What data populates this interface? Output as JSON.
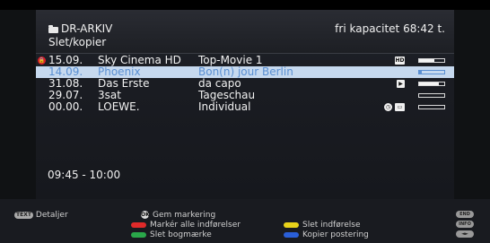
{
  "header": {
    "title_line1": "DR-ARKIV",
    "title_line2": "Slet/kopier",
    "capacity": "fri kapacitet 68:42 t."
  },
  "recordings": [
    {
      "date": "15.09.",
      "channel": "Sky Cinema HD",
      "title": "Top-Movie 1",
      "locked": true,
      "icons": [
        "hd-icon"
      ],
      "progress": 0.6
    },
    {
      "date": "14.09.",
      "channel": "Phoenix",
      "title": "Bon(n) jour Berlin",
      "selected": true,
      "icons": [],
      "progress": 0.1
    },
    {
      "date": "31.08.",
      "channel": "Das Erste",
      "title": "da capo",
      "icons": [
        "play-icon"
      ],
      "progress": 0.8
    },
    {
      "date": "29.07.",
      "channel": "3sat",
      "title": "Tageschau",
      "icons": [],
      "progress": 0.0
    },
    {
      "date": "00.00.",
      "channel": "LOEWE.",
      "title": "Individual",
      "icons": [
        "clock-icon",
        "folder-icon"
      ],
      "progress": 0.0
    }
  ],
  "time_range": "09:45 - 10:00",
  "footer": {
    "text_key": "TEXT",
    "text_label": "Detaljer",
    "ok_key": "OK",
    "ok_label": "Gem markering",
    "red_label": "Markér alle indførelser",
    "green_label": "Slet bogmærke",
    "yellow_label": "Slet indførelse",
    "blue_label": "Kopier postering",
    "end_key": "END",
    "info_key": "INFO",
    "arrows_key": "◄►"
  },
  "colors": {
    "red": "#e02a2a",
    "green": "#2aa84a",
    "yellow": "#e8d21a",
    "blue": "#2a5fd8",
    "selected_bg": "#c6d9ef",
    "selected_text": "#5a8fd2"
  }
}
